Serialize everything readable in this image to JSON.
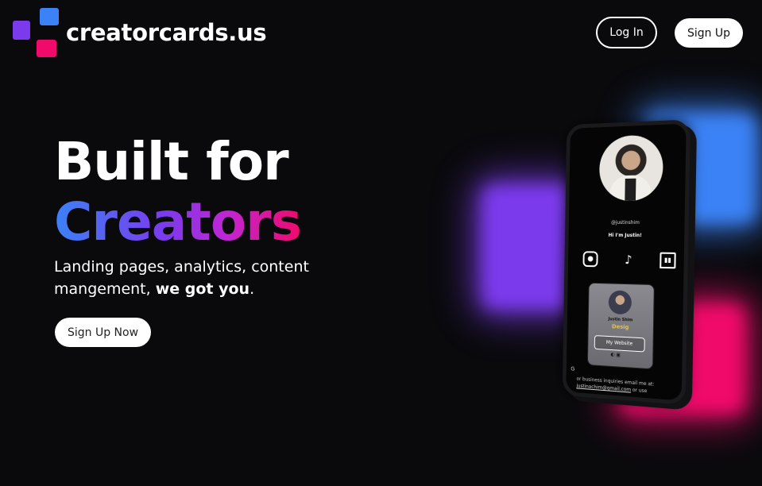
{
  "header": {
    "brand": "creatorcards.us",
    "login_label": "Log In",
    "signup_label": "Sign Up"
  },
  "hero": {
    "title_line1": "Built for",
    "title_line2": "Creators",
    "subtitle_part1": "Landing pages, analytics, content mangement, ",
    "subtitle_bold": "we got you",
    "subtitle_end": ".",
    "cta_label": "Sign Up Now"
  },
  "phone": {
    "handle": "@justinshim",
    "greeting": "Hi I'm Justin!",
    "socials": [
      "instagram-icon",
      "tiktok-icon",
      "twitch-icon"
    ],
    "card_name": "Justin Shim",
    "card_role": "Desig",
    "card_button": "My Website",
    "footer_text": "or business inquiries email me at:",
    "footer_email": "justinachim@gmail.com",
    "footer_tail": " or use"
  },
  "colors": {
    "background": "#0a0a0d",
    "blue": "#3b82f6",
    "purple": "#7c3aed",
    "pink": "#f00a6a"
  }
}
